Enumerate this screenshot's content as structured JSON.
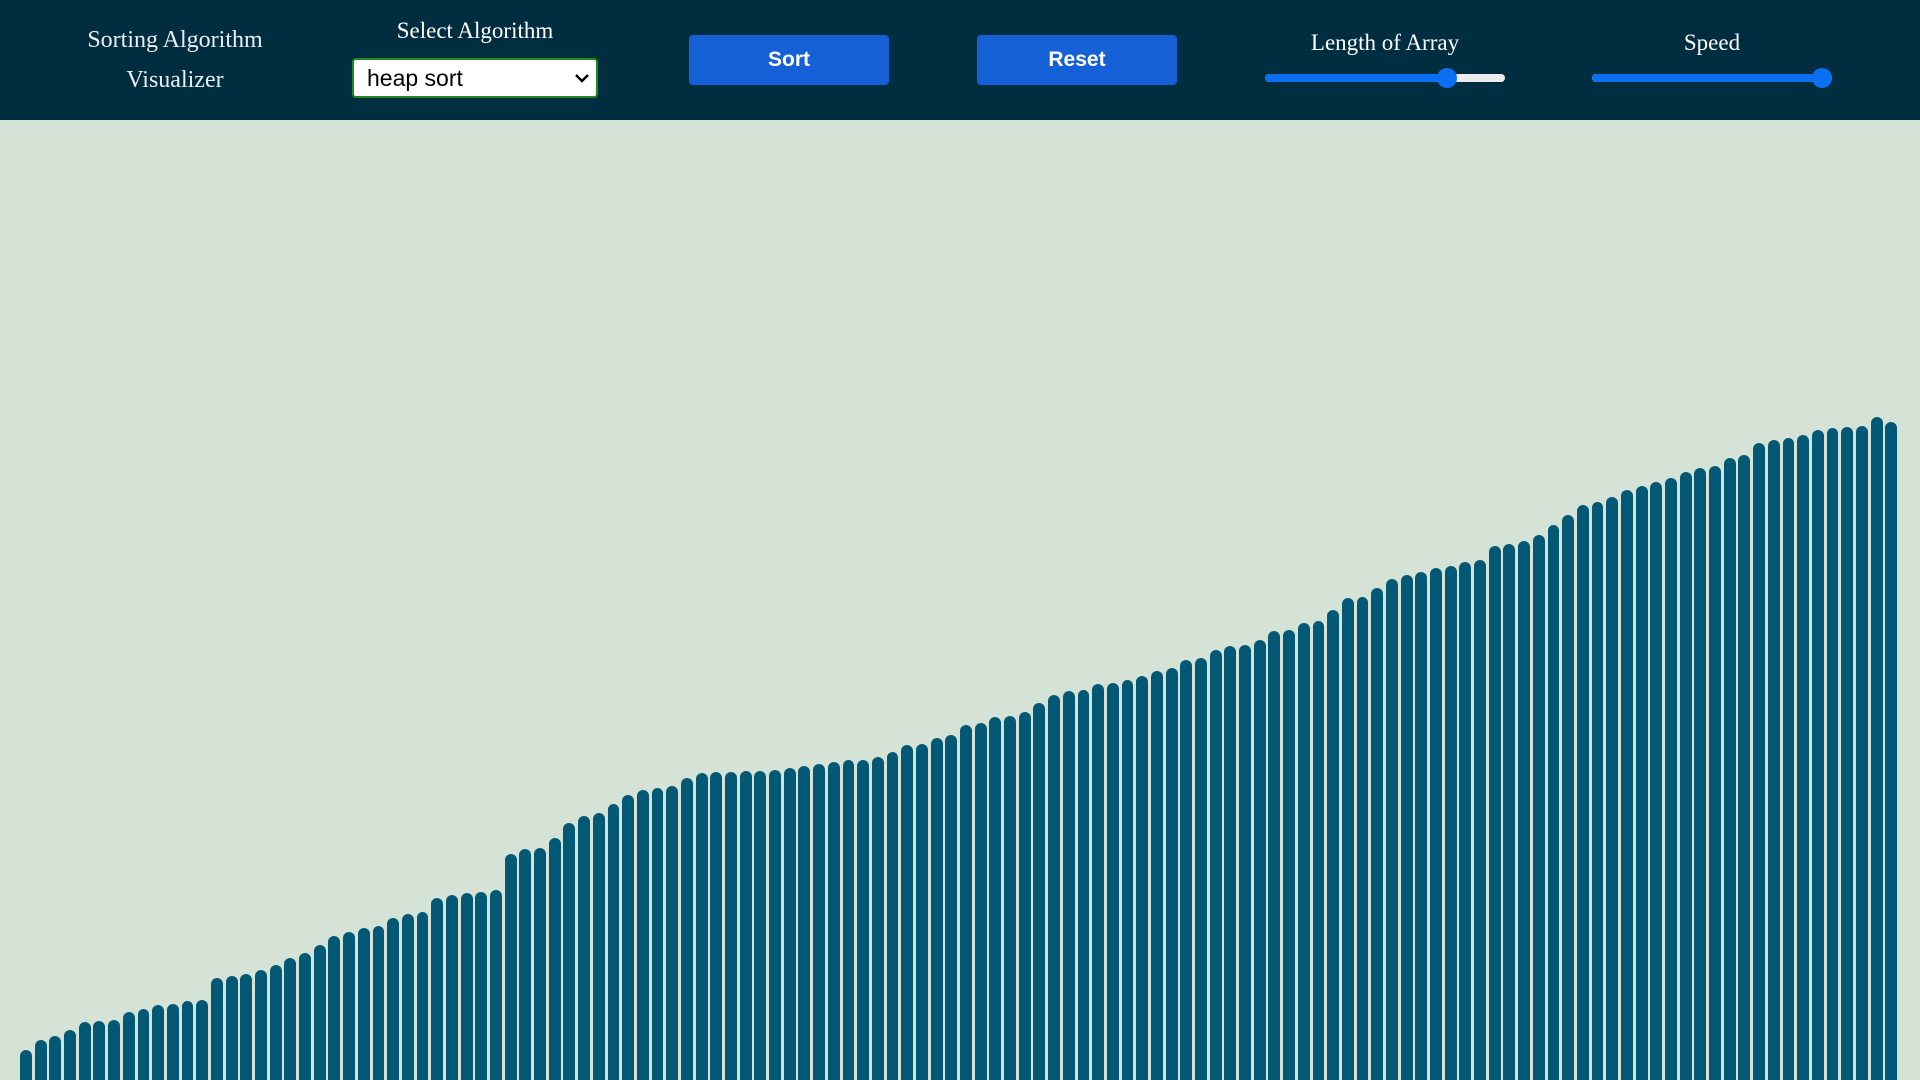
{
  "header": {
    "title_line1": "Sorting Algorithm",
    "title_line2": "Visualizer",
    "select_label": "Select Algorithm",
    "selected_algorithm": "heap sort",
    "sort_label": "Sort",
    "reset_label": "Reset",
    "length_label": "Length of Array",
    "length_value_fraction": 0.76,
    "speed_label": "Speed",
    "speed_value_fraction": 0.96
  },
  "colors": {
    "navbar": "#002d40",
    "background": "#d4e3d6",
    "bar": "#035975",
    "button": "#1560d6",
    "slider": "#0a6ff0"
  },
  "icons": {
    "dropdown": "chevron-down-icon"
  },
  "array": {
    "state": "sorted",
    "max_value": 960,
    "values": [
      30,
      40,
      44,
      50,
      58,
      59,
      60,
      68,
      71,
      75,
      76,
      79,
      80,
      102,
      104,
      106,
      110,
      115,
      122,
      127,
      135,
      144,
      148,
      152,
      154,
      162,
      166,
      168,
      182,
      185,
      187,
      188,
      190,
      226,
      231,
      232,
      242,
      257,
      264,
      267,
      276,
      285,
      290,
      292,
      294,
      302,
      307,
      308,
      308,
      309,
      309,
      310,
      312,
      314,
      316,
      318,
      320,
      320,
      323,
      328,
      335,
      336,
      342,
      345,
      355,
      357,
      363,
      364,
      368,
      377,
      385,
      389,
      390,
      396,
      397,
      400,
      404,
      409,
      412,
      420,
      422,
      430,
      434,
      435,
      440,
      449,
      450,
      457,
      459,
      470,
      482,
      483,
      492,
      501,
      505,
      508,
      512,
      514,
      518,
      520,
      534,
      536,
      539,
      545,
      555,
      565,
      575,
      578,
      583,
      590,
      594,
      598,
      602,
      608,
      612,
      614,
      622,
      625,
      637,
      640,
      642,
      645,
      650,
      652,
      653,
      654,
      663,
      658
    ]
  }
}
